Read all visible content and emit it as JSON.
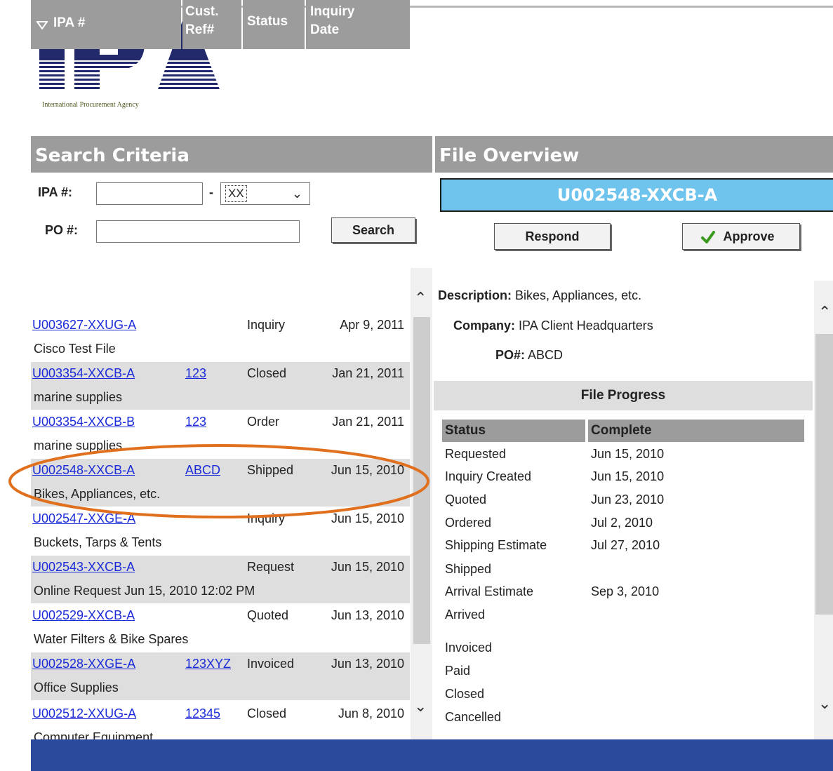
{
  "logo": {
    "text": "IPA",
    "caption": "International Procurement Agency"
  },
  "search_panel": {
    "title": "Search Criteria",
    "ipa_label": "IPA #:",
    "dash": "-",
    "suffix_selected": "XX",
    "po_label": "PO #:",
    "search_button": "Search"
  },
  "table": {
    "headers": {
      "sort_icon": "triangle-down-icon",
      "ipa": "IPA #",
      "cust_ref_1": "Cust.",
      "cust_ref_2": "Ref#",
      "status": "Status",
      "inquiry_1": "Inquiry",
      "inquiry_2": "Date"
    },
    "rows": [
      {
        "ipa": "U003627-XXUG-A",
        "ref": "",
        "status": "Inquiry",
        "date": "Apr 9, 2011",
        "desc": "Cisco Test File"
      },
      {
        "ipa": "U003354-XXCB-A",
        "ref": "123",
        "status": "Closed",
        "date": "Jan 21, 2011",
        "desc": "marine supplies"
      },
      {
        "ipa": "U003354-XXCB-B",
        "ref": "123",
        "status": "Order",
        "date": "Jan 21, 2011",
        "desc": "marine supplies"
      },
      {
        "ipa": "U002548-XXCB-A",
        "ref": "ABCD",
        "status": "Shipped",
        "date": "Jun 15, 2010",
        "desc": "Bikes, Appliances, etc."
      },
      {
        "ipa": "U002547-XXGE-A",
        "ref": "",
        "status": "Inquiry",
        "date": "Jun 15, 2010",
        "desc": "Buckets, Tarps & Tents"
      },
      {
        "ipa": "U002543-XXCB-A",
        "ref": "",
        "status": "Request",
        "date": "Jun 15, 2010",
        "desc": "Online Request Jun 15, 2010 12:02 PM"
      },
      {
        "ipa": "U002529-XXCB-A",
        "ref": "",
        "status": "Quoted",
        "date": "Jun 13, 2010",
        "desc": "Water Filters & Bike Spares"
      },
      {
        "ipa": "U002528-XXGE-A",
        "ref": "123XYZ",
        "status": "Invoiced",
        "date": "Jun 13, 2010",
        "desc": "Office Supplies"
      },
      {
        "ipa": "U002512-XXUG-A",
        "ref": "12345",
        "status": "Closed",
        "date": "Jun 8, 2010",
        "desc": "Computer Equipment"
      }
    ]
  },
  "overview": {
    "title": "File Overview",
    "file_id": "U002548-XXCB-A",
    "respond_button": "Respond",
    "approve_button": "Approve",
    "description_label": "Description:",
    "description_value": "Bikes, Appliances, etc.",
    "company_label": "Company:",
    "company_value": "IPA Client Headquarters",
    "po_label": "PO#:",
    "po_value": "ABCD",
    "progress_title": "File Progress",
    "col_status": "Status",
    "col_complete": "Complete",
    "steps": [
      {
        "status": "Requested",
        "complete": "Jun 15, 2010"
      },
      {
        "status": "Inquiry Created",
        "complete": "Jun 15, 2010"
      },
      {
        "status": "Quoted",
        "complete": "Jun 23, 2010"
      },
      {
        "status": "Ordered",
        "complete": "Jul 2, 2010"
      },
      {
        "status": "Shipping Estimate",
        "complete": "Jul 27, 2010"
      },
      {
        "status": "Shipped",
        "complete": ""
      },
      {
        "status": "Arrival Estimate",
        "complete": "Sep 3, 2010"
      },
      {
        "status": "Arrived",
        "complete": ""
      },
      {
        "status": "Invoiced",
        "complete": ""
      },
      {
        "status": "Paid",
        "complete": ""
      },
      {
        "status": "Closed",
        "complete": ""
      },
      {
        "status": "Cancelled",
        "complete": ""
      }
    ]
  },
  "colors": {
    "logo_navy": "#232a6b",
    "header_gray": "#9c9c9c",
    "link_blue": "#1b2bd8",
    "file_id_bg": "#6fc4ee",
    "footer_blue": "#2b4a9c",
    "highlight_orange": "#e0701e"
  }
}
